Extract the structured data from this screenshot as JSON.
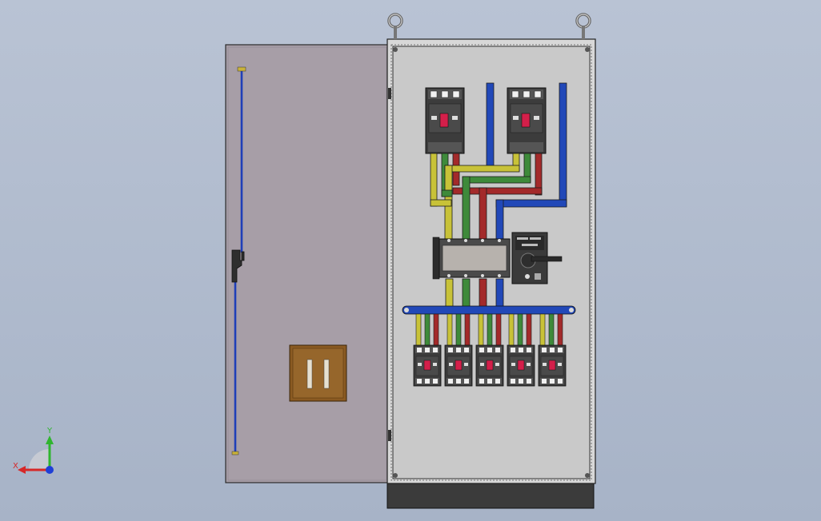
{
  "viewport": {
    "background_top": "#b9c3d4",
    "background_bottom": "#a7b3c7"
  },
  "colors": {
    "door": "#a79ea7",
    "panel": "#c9c9c9",
    "cabinet_frame": "#d8d8d8",
    "plinth": "#3b3b3b",
    "bus_yellow": "#c8c238",
    "bus_green": "#3e8a3a",
    "bus_red": "#a32a2a",
    "bus_blue": "#2148b8",
    "lock_box": "#8a5a22",
    "breaker_body": "#3c3c3c",
    "breaker_handle": "#d41f4a"
  },
  "triad": {
    "x_label": "X",
    "y_label": "Y",
    "x_color": "#d62828",
    "y_color": "#2fb52f",
    "z_color": "#1f3fd6"
  },
  "components": {
    "main_breakers": [
      "main-breaker-left",
      "main-breaker-right"
    ],
    "transfer_switch": "ats-unit",
    "controller": "ats-controller",
    "branch_breakers": [
      "branch-1",
      "branch-2",
      "branch-3",
      "branch-4",
      "branch-5"
    ],
    "lifting_eyes": [
      "lifting-eye-left",
      "lifting-eye-right"
    ]
  }
}
